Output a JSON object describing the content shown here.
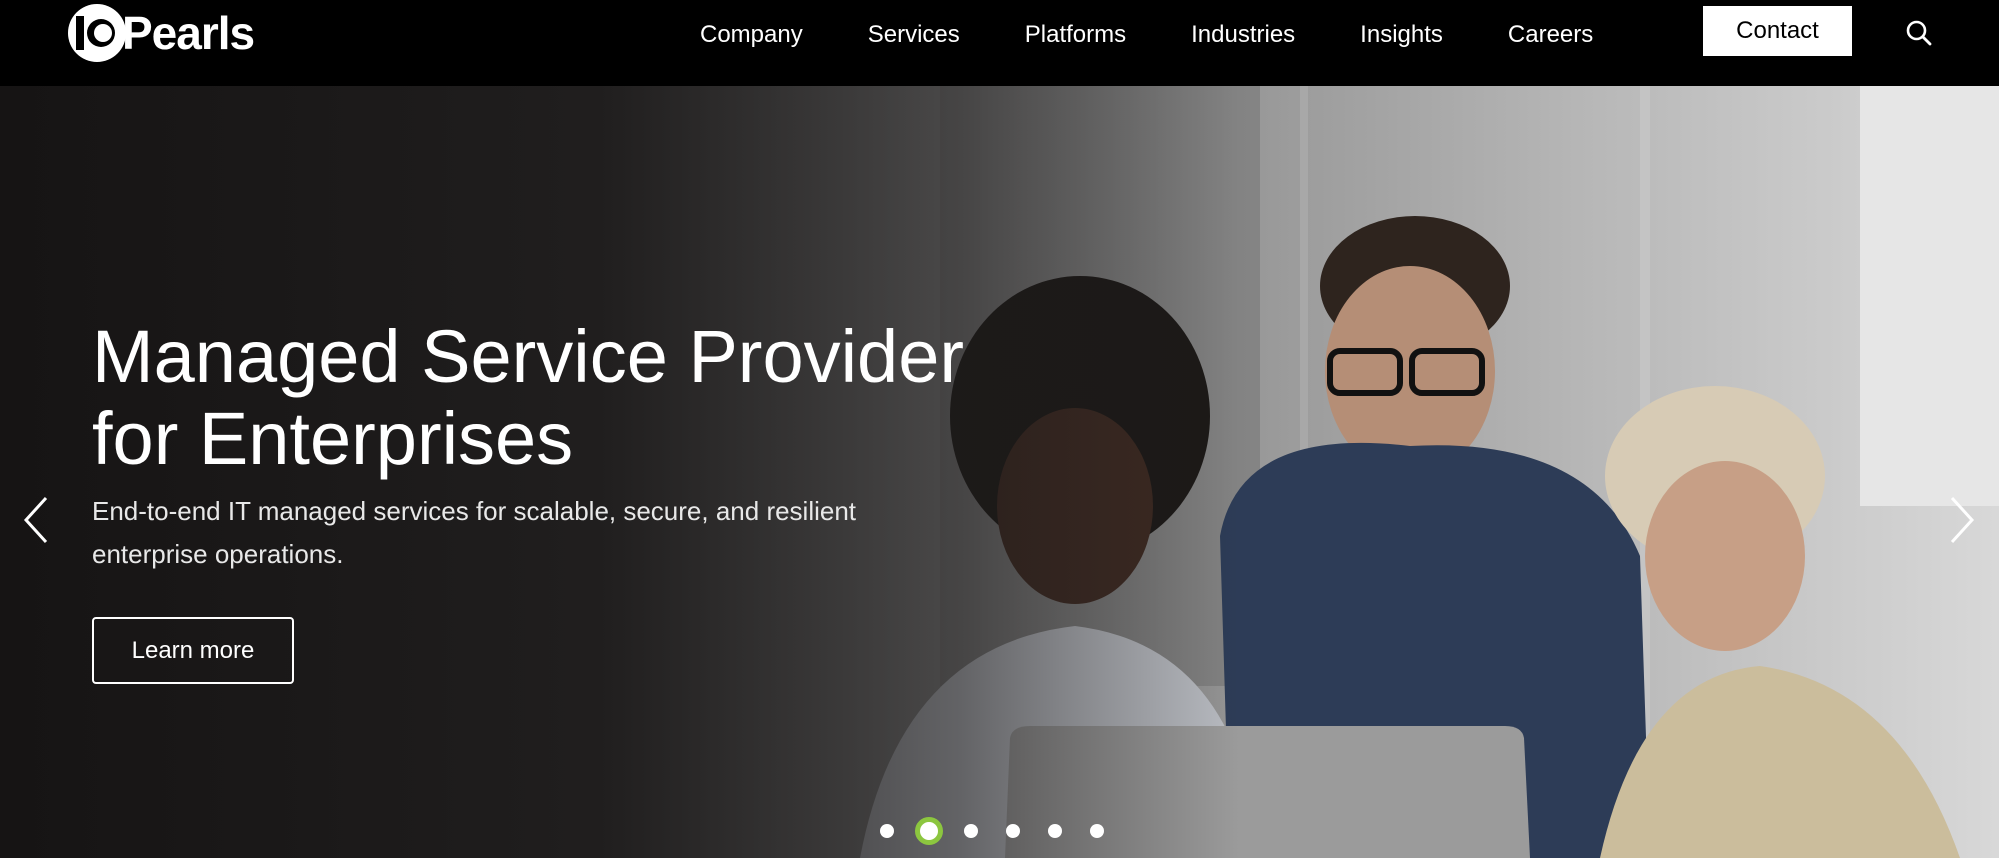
{
  "header": {
    "logo": {
      "mark": "10",
      "word": "Pearls"
    },
    "nav_items": [
      {
        "label": "Company"
      },
      {
        "label": "Services"
      },
      {
        "label": "Platforms"
      },
      {
        "label": "Industries"
      },
      {
        "label": "Insights"
      },
      {
        "label": "Careers"
      }
    ],
    "contact_label": "Contact",
    "search_icon": "search-icon"
  },
  "hero": {
    "title_line1": "Managed Service Provider",
    "title_line2": "for Enterprises",
    "subtitle_line1": "End-to-end IT managed services for scalable, secure, and resilient",
    "subtitle_line2": "enterprise operations.",
    "cta_label": "Learn more",
    "prev_icon": "chevron-left-icon",
    "next_icon": "chevron-right-icon"
  },
  "carousel": {
    "slide_count": 6,
    "active_index": 1,
    "active_color": "#8cc63f"
  },
  "colors": {
    "nav_background": "#000000",
    "contact_background": "#ffffff",
    "accent": "#8cc63f"
  }
}
